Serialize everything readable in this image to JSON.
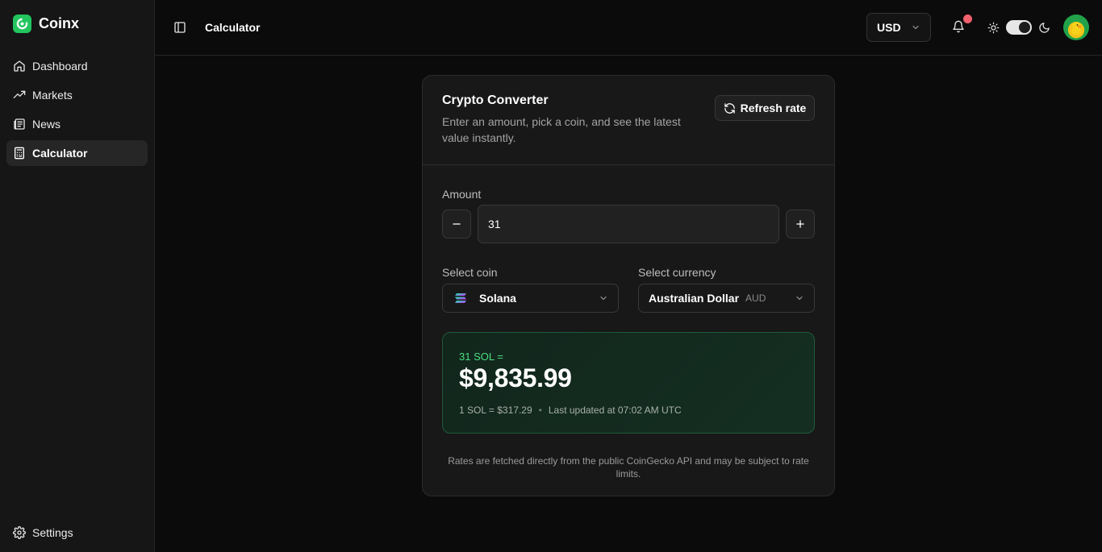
{
  "app": {
    "name": "Coinx"
  },
  "sidebar": {
    "items": [
      {
        "label": "Dashboard",
        "icon": "home-icon"
      },
      {
        "label": "Markets",
        "icon": "trending-up-icon"
      },
      {
        "label": "News",
        "icon": "newspaper-icon"
      },
      {
        "label": "Calculator",
        "icon": "calculator-icon",
        "active": true
      }
    ],
    "settings_label": "Settings"
  },
  "topbar": {
    "title": "Calculator",
    "currency": "USD",
    "notification_dot_color": "#f0616d",
    "theme": "dark"
  },
  "converter": {
    "title": "Crypto Converter",
    "description": "Enter an amount, pick a coin, and see the latest value instantly.",
    "refresh_label": "Refresh rate",
    "amount_label": "Amount",
    "amount_value": "31",
    "coin_label": "Select coin",
    "coin_value": "Solana",
    "currency_label": "Select currency",
    "currency_value": "Australian Dollar",
    "currency_code": "AUD",
    "result_label": "31 SOL =",
    "result_value": "$9,835.99",
    "rate_text": "1 SOL = $317.29",
    "separator": "•",
    "updated_text": "Last updated at 07:02 AM UTC",
    "footnote": "Rates are fetched directly from the public CoinGecko API and may be subject to rate limits."
  },
  "colors": {
    "accent": "#22c55e",
    "result_label": "#4ade80",
    "background": "#0b0b0b",
    "sidebar": "#161616"
  }
}
